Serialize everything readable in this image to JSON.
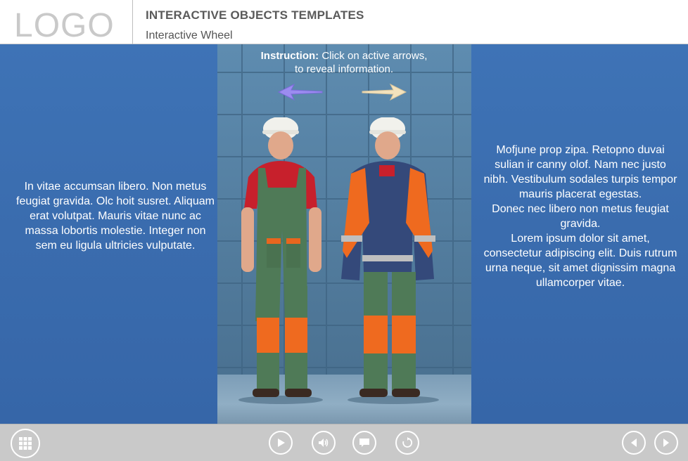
{
  "header": {
    "logo": "LOGO",
    "title": "INTERACTIVE OBJECTS TEMPLATES",
    "subtitle": "Interactive Wheel"
  },
  "main": {
    "instruction_label": "Instruction:",
    "instruction_text": "Click on active arrows,",
    "instruction_text_2": "to reveal information.",
    "left_text": "In vitae accumsan libero. Non metus feugiat gravida. Olc hoit susret. Aliquam erat volutpat. Mauris vitae nunc ac massa lobortis molestie. Integer non sem eu ligula ultricies vulputate.",
    "right_text_1": "Mofjune prop zipa. Retopno duvai sulian ir canny olof. Nam nec justo nibh. Vestibulum sodales turpis tempor mauris placerat egestas.",
    "right_text_2": "Donec nec libero non metus feugiat gravida.",
    "right_text_3": "Lorem ipsum dolor sit amet, consectetur adipiscing elit. Duis rutrum urna neque, sit amet dignissim magna ullamcorper vitae."
  },
  "colors": {
    "panel_blue": "#3c6eb0",
    "arrow_left": "#9b8cf0",
    "arrow_right": "#f3e2bd",
    "footer_gray": "#c9c9c9"
  },
  "footer": {
    "icons": [
      "grid-menu-icon",
      "play-icon",
      "audio-icon",
      "chat-icon",
      "replay-icon",
      "prev-icon",
      "next-icon"
    ]
  }
}
